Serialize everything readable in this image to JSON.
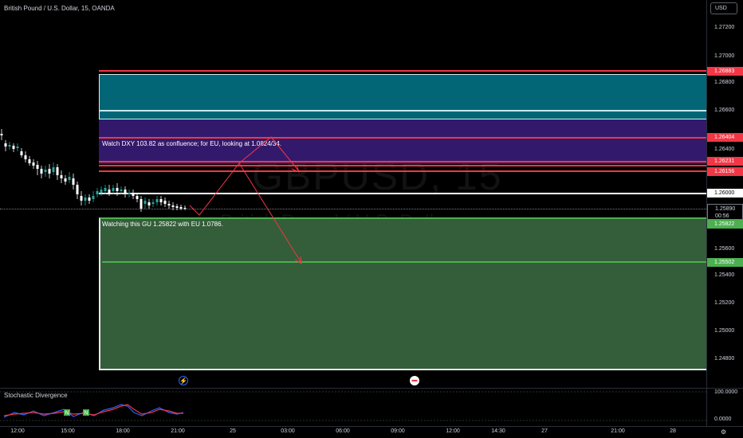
{
  "chart": {
    "title": "British Pound / U.S. Dollar, 15, OANDA",
    "watermark_symbol": "GBPUSD, 15",
    "watermark_desc": "British Pound / U.S. Dollar",
    "currency": "USD"
  },
  "notes": {
    "dxy": "Watch DXY 103.82 as confluence; for EU, looking at 1.0824/34.",
    "gu": "Watching this GU 1.25822 with EU 1.0786."
  },
  "price_axis": {
    "ticks": [
      "1.27200",
      "1.27000",
      "1.26800",
      "1.26600",
      "1.26400",
      "1.26000",
      "1.25600",
      "1.25400",
      "1.25200",
      "1.25000",
      "1.24800"
    ],
    "labels": {
      "l_26883": "1.26883",
      "l_26404": "1.26404",
      "l_26231": "1.26231",
      "l_26156": "1.26156",
      "l_26000": "1.26000",
      "l_current": "1.25890",
      "l_countdown": "00:56",
      "l_25822": "1.25822",
      "l_25502": "1.25502"
    }
  },
  "indicator": {
    "title": "Stochastic Divergence",
    "ticks": [
      "100.0000",
      "0.0000"
    ],
    "badge": "N"
  },
  "time_axis": {
    "ticks": [
      "12:00",
      "15:00",
      "18:00",
      "21:00",
      "25",
      "03:00",
      "06:00",
      "09:00",
      "12:00",
      "14:30",
      "27",
      "21:00",
      "28"
    ]
  },
  "colors": {
    "red": "#f23645",
    "green": "#4caf50",
    "teal_zone": "#026677",
    "purple_zone": "#33196b",
    "green_zone": "#345d3a",
    "candle_up": "#26a69a",
    "candle_down": "#ffffff"
  },
  "icons": {
    "flash": "lightning-icon",
    "flag": "us-flag-icon",
    "settings": "gear-icon"
  }
}
